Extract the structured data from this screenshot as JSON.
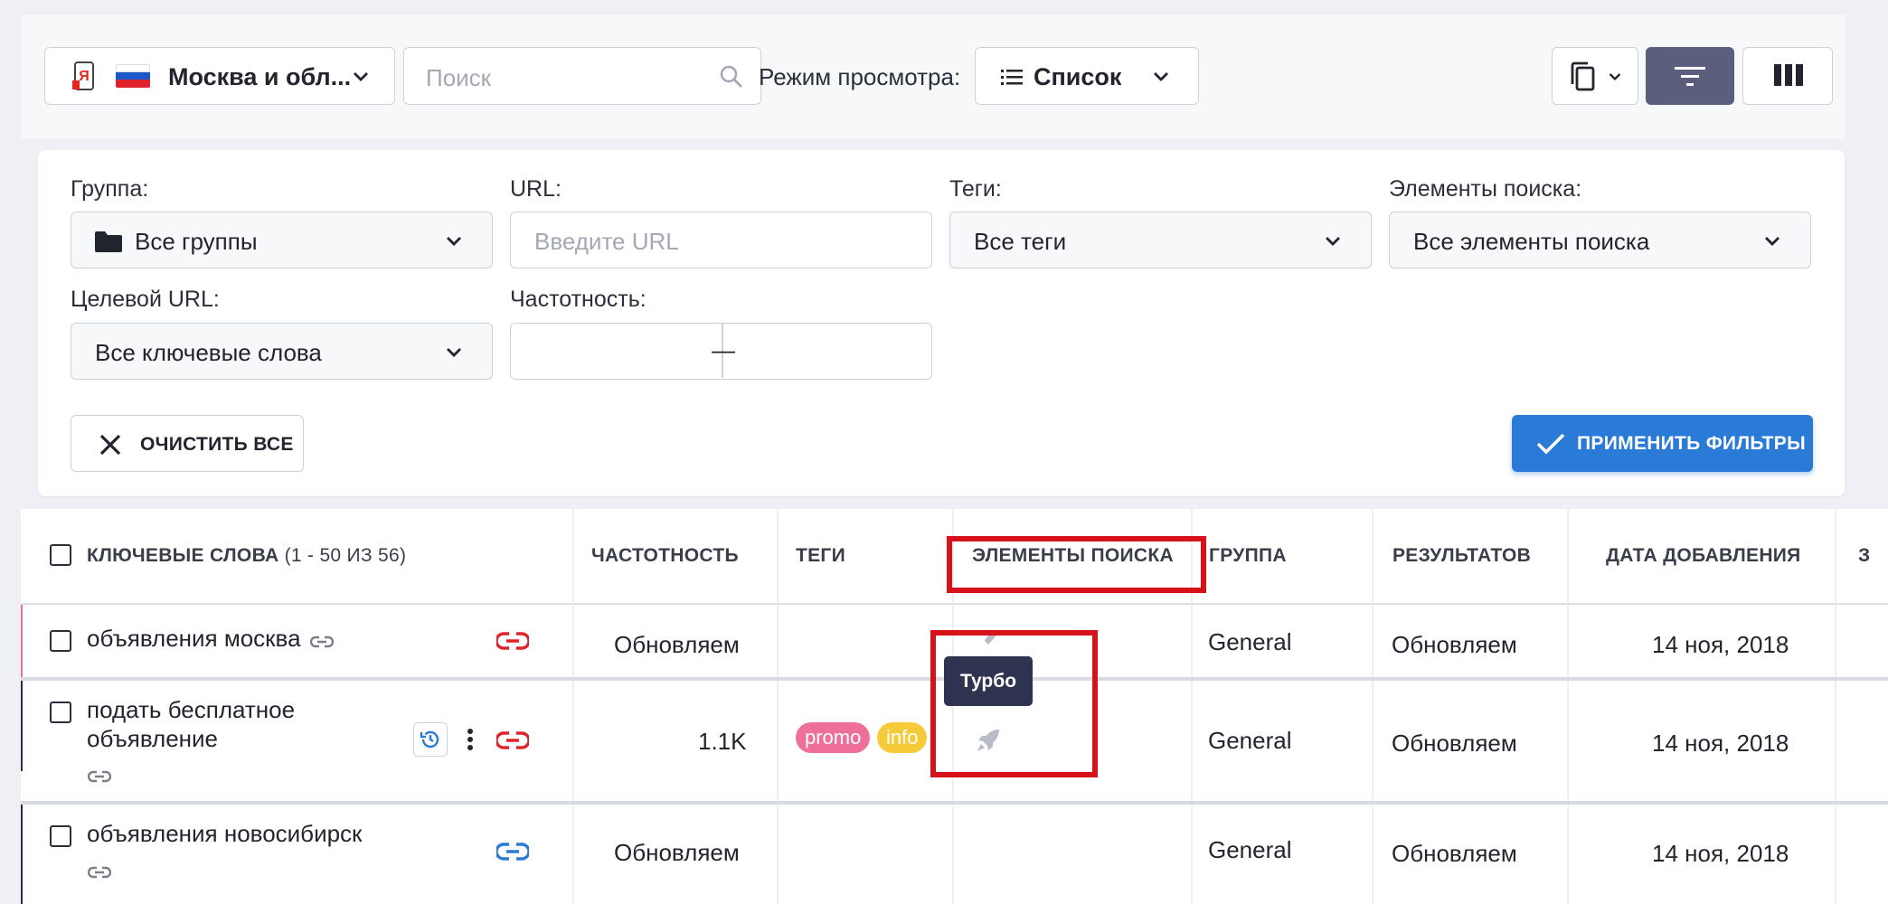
{
  "toolbar": {
    "region": {
      "label": "Москва и обл...",
      "engine_icon": "yandex-icon",
      "flag": "russia-flag"
    },
    "search": {
      "placeholder": "Поиск"
    },
    "view_mode": {
      "label": "Режим просмотра:",
      "value": "Список"
    },
    "accent_color": "#5b5e7c"
  },
  "filters": {
    "group": {
      "label": "Группа:",
      "value": "Все группы"
    },
    "url": {
      "label": "URL:",
      "placeholder": "Введите URL"
    },
    "tags": {
      "label": "Теги:",
      "value": "Все теги"
    },
    "search_elements": {
      "label": "Элементы поиска:",
      "value": "Все элементы поиска"
    },
    "target_url": {
      "label": "Целевой URL:",
      "value": "Все ключевые слова"
    },
    "frequency": {
      "label": "Частотность:",
      "separator": "—"
    },
    "clear_button": "ОЧИСТИТЬ ВСЕ",
    "apply_button": "ПРИМЕНИТЬ ФИЛЬТРЫ",
    "apply_color": "#2a7ad8"
  },
  "table": {
    "headers": {
      "keywords": "КЛЮЧЕВЫЕ СЛОВА",
      "keywords_count": "(1 - 50 ИЗ 56)",
      "frequency": "ЧАСТОТНОСТЬ",
      "tags": "ТЕГИ",
      "search_elements": "ЭЛЕМЕНТЫ ПОИСКА",
      "group": "ГРУППА",
      "results": "РЕЗУЛЬТАТОВ",
      "date_added": "ДАТА ДОБАВЛЕНИЯ",
      "next_col": "З"
    },
    "rows": [
      {
        "keyword": "объявления москва",
        "frequency": "Обновляем",
        "group": "General",
        "results": "Обновляем",
        "date": "14 ноя, 2018"
      },
      {
        "keyword": "подать бесплатное объявление",
        "frequency": "1.1K",
        "tags": [
          {
            "label": "promo",
            "color": "#ee6f9a"
          },
          {
            "label": "info",
            "color": "#f5cb3a"
          }
        ],
        "group": "General",
        "results": "Обновляем",
        "date": "14 ноя, 2018"
      },
      {
        "keyword": "объявления новосибирск",
        "frequency": "Обновляем",
        "group": "General",
        "results": "Обновляем",
        "date": "14 ноя, 2018"
      }
    ]
  },
  "tooltip": {
    "text": "Турбо"
  },
  "highlight_color": "#d6121a"
}
